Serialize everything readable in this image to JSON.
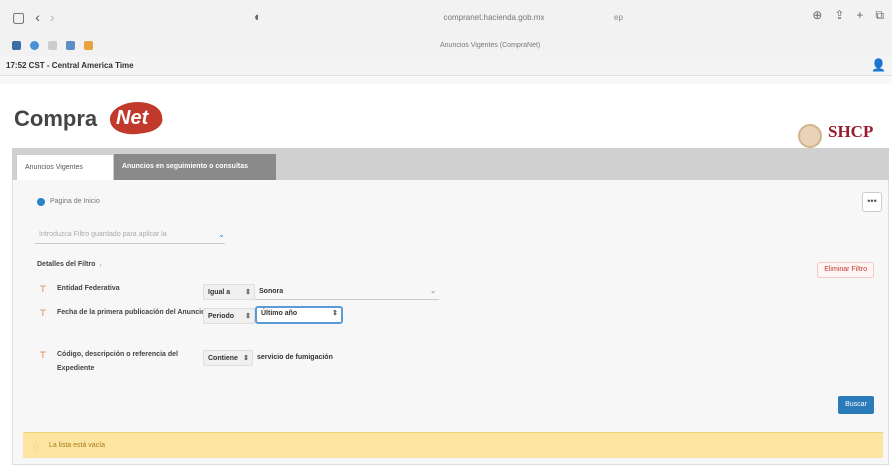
{
  "browser": {
    "url": "compranet.hacienda.gob.mx",
    "url_suffix": "ep",
    "tab_title": "Anuncios Vigentes (CompraNet)"
  },
  "session_bar": {
    "time_text": "17:52 CST - Central America Time"
  },
  "header": {
    "logo_text_main": "Compra",
    "logo_text_accent": "Net",
    "agency_logo_text": "SHCP"
  },
  "tabs": [
    {
      "label": "Anuncios Vigentes",
      "active": true
    },
    {
      "label": "Anuncios en seguimiento o consultas",
      "active": false
    }
  ],
  "panel": {
    "home_link": "Pagina de Inicio",
    "more_label": "•••",
    "filter_placeholder": "Introduzca Filtro guardado para aplicar la",
    "details_label": "Detalles del Filtro",
    "clear_filters": "Eliminar Filtro",
    "search_button": "Buscar",
    "alert_text": "La lista está vacía"
  },
  "criteria": [
    {
      "label": "Entidad Federativa",
      "operator": "Igual a",
      "value": "Sonora"
    },
    {
      "label": "Fecha de la primera publicación del Anuncio",
      "operator": "Periodo",
      "value": "Último año"
    },
    {
      "label": "Código, descripción o referencia del Expediente",
      "operator": "Contiene",
      "value": "servicio de fumigación"
    }
  ],
  "colors": {
    "brand_red": "#c0392b",
    "primary_blue": "#2b7bb9",
    "alert_bg": "#fbe5a0",
    "shcp_maroon": "#9b1c31"
  }
}
